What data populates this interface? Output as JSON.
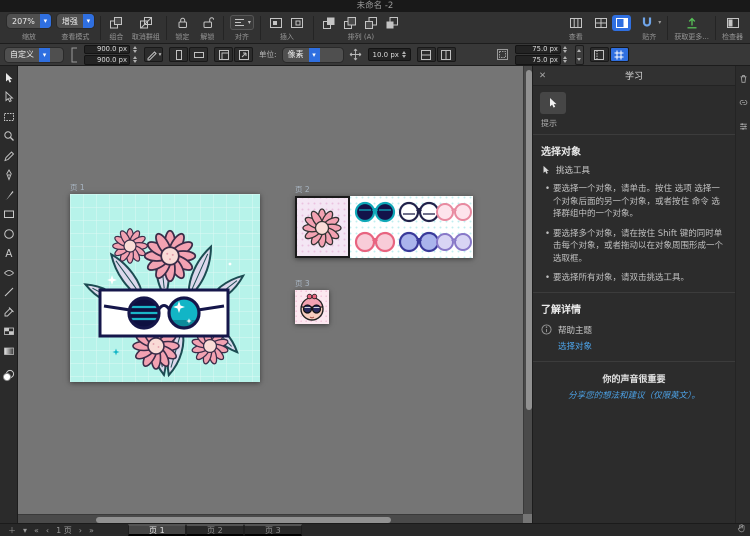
{
  "window": {
    "title": "未命名 -2"
  },
  "icons": {
    "chevron_down": "▾",
    "close": "✕",
    "plus": "＋",
    "nav_first": "«",
    "nav_prev": "‹",
    "nav_next": "›",
    "nav_last": "»"
  },
  "toolbar": {
    "zoom_value": "207%",
    "viewmode_value": "增强",
    "labels": {
      "zoom": "缩放",
      "viewmode": "查看模式",
      "group": "组合",
      "ungroup": "取消群组",
      "lock": "锁定",
      "unlock": "解锁",
      "align": "对齐",
      "insert": "插入",
      "arrange": "排列 (A)",
      "view": "查看",
      "snap": "贴齐",
      "getmore": "获取更多...",
      "inspector": "检查器"
    }
  },
  "context_toolbar": {
    "preset_value": "自定义",
    "width_value": "900.0 px",
    "height_value": "900.0 px",
    "units_label": "单位:",
    "units_value": "像素",
    "spacing_value": "10.0 px",
    "margin_h_value": "75.0 px",
    "margin_v_value": "75.0 px"
  },
  "canvas": {
    "artboards": [
      {
        "label": "页 1"
      },
      {
        "label": "页 2"
      },
      {
        "label": "页 3"
      }
    ]
  },
  "learn_panel": {
    "title": "学习",
    "tips_label": "提示",
    "section_title": "选择对象",
    "tool_label": "挑选工具",
    "bullets": [
      "要选择一个对象，请单击。按住 选项 选择一个对象后面的另一个对象，或者按住 命令 选择群组中的一个对象。",
      "要选择多个对象，请在按住 Shift 键的同时单击每个对象，或者拖动以在对象周围形成一个选取框。",
      "要选择所有对象，请双击挑选工具。"
    ],
    "more_title": "了解详情",
    "help_topics_label": "帮助主题",
    "help_link_label": "选择对象",
    "voice_title": "你的声音很重要",
    "voice_link_label": "分享您的想法和建议（仅限英文）。"
  },
  "statusbar": {
    "page_indicator": "1 页",
    "tabs": [
      "页 1",
      "页 2",
      "页 3"
    ]
  },
  "colors": {
    "accent": "#2f6fe0",
    "link": "#4da3e8",
    "artboard_mint": "#b7f3ea",
    "flower_pink": "#f3a2b2",
    "teal": "#13b5c6",
    "getmore_green": "#57c257"
  }
}
